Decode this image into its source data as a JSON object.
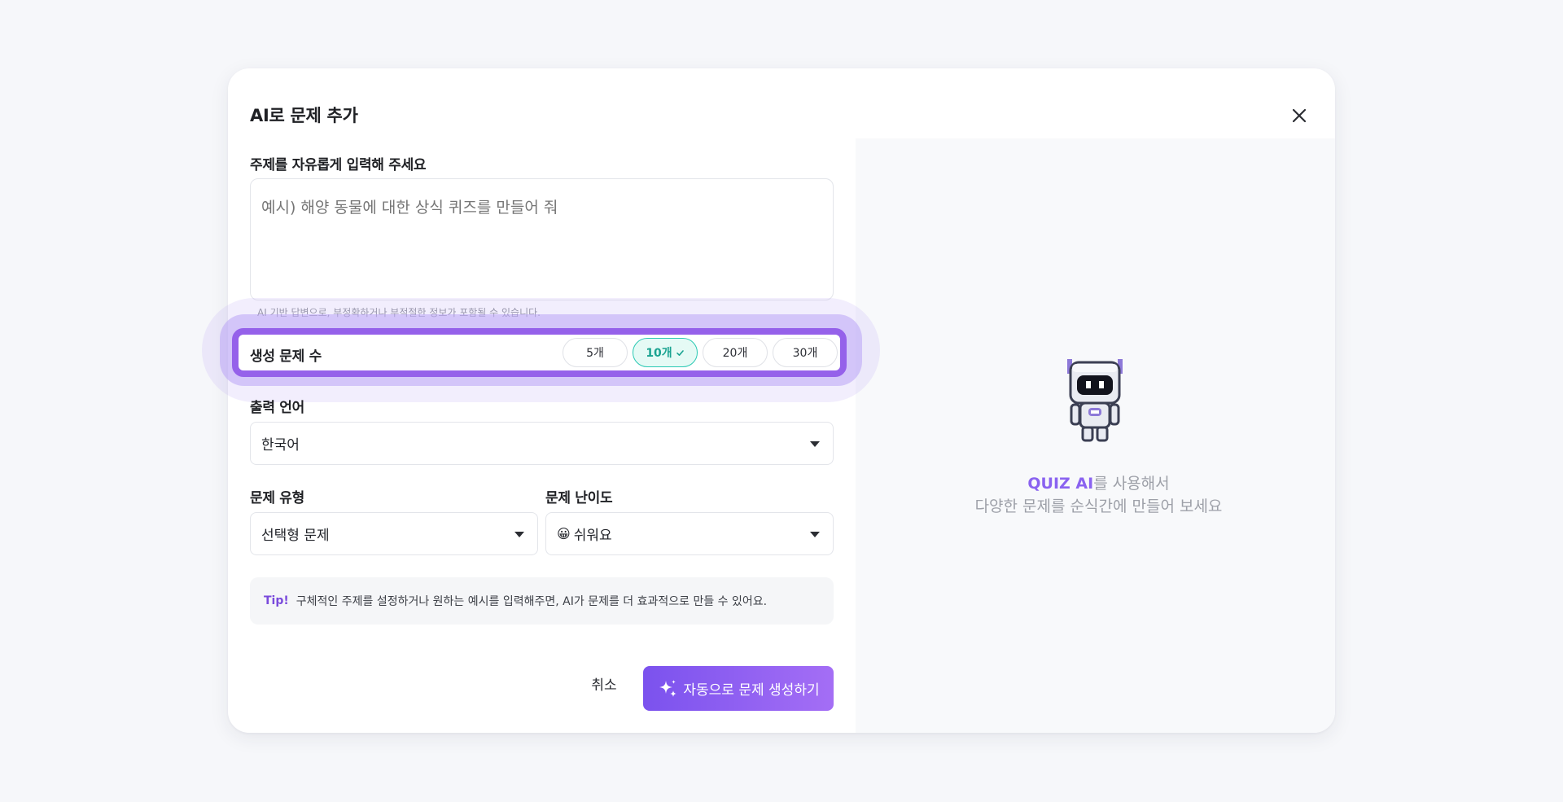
{
  "modal": {
    "title": "AI로 문제 추가",
    "close_icon": "close-icon"
  },
  "topic": {
    "label": "주제를 자유롭게 입력해 주세요",
    "placeholder": "예시) 해양 동물에 대한 상식 퀴즈를 만들어 줘",
    "value": "",
    "disclaimer": "AI 기반 답변으로, 부정확하거나 부적절한 정보가 포함될 수 있습니다."
  },
  "count": {
    "label": "생성 문제 수",
    "options": [
      {
        "label": "5개",
        "selected": false
      },
      {
        "label": "10개",
        "selected": true
      },
      {
        "label": "20개",
        "selected": false
      },
      {
        "label": "30개",
        "selected": false
      }
    ],
    "highlight_color": "#9561ea",
    "selected_color": "#2bc9b4"
  },
  "language": {
    "label": "출력 언어",
    "value": "한국어"
  },
  "type": {
    "label": "문제 유형",
    "value": "선택형 문제"
  },
  "difficulty": {
    "label": "문제 난이도",
    "emoji": "😀",
    "value": "쉬워요"
  },
  "tip": {
    "title": "Tip!",
    "text": "구체적인 주제를 설정하거나 원하는 예시를 입력해주면, AI가 문제를 더 효과적으로 만들 수 있어요."
  },
  "actions": {
    "cancel_label": "취소",
    "generate_label": "자동으로 문제 생성하기",
    "generate_icon": "sparkle-icon",
    "accent_color": "#8a5cf0"
  },
  "promo": {
    "brand": "QUIZ AI",
    "line1_suffix": "를 사용해서",
    "line2": "다양한 문제를 순식간에 만들어 보세요",
    "mascot_icon": "robot-mascot-icon"
  }
}
